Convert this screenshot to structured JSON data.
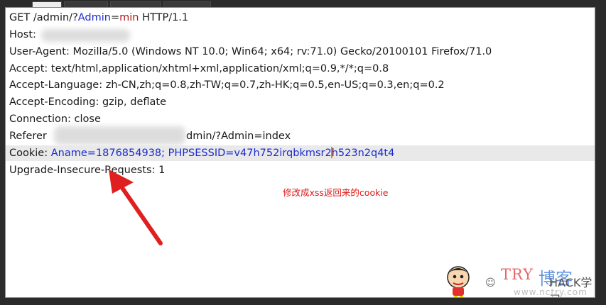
{
  "request": {
    "line1": {
      "method_path": "GET /admin/?",
      "param_key": "Admin",
      "eq": "=",
      "param_val": "min",
      "proto": " HTTP/1.1"
    },
    "host": "Host:",
    "user_agent": "User-Agent: Mozilla/5.0 (Windows NT 10.0; Win64; x64; rv:71.0) Gecko/20100101 Firefox/71.0",
    "accept": "Accept: text/html,application/xhtml+xml,application/xml;q=0.9,*/*;q=0.8",
    "accept_language": "Accept-Language: zh-CN,zh;q=0.8,zh-TW;q=0.7,zh-HK;q=0.5,en-US;q=0.3,en;q=0.2",
    "accept_encoding": "Accept-Encoding: gzip, deflate",
    "connection": "Connection: close",
    "referer_label": "Referer",
    "referer_tail": "dmin/?Admin=index",
    "cookie_label": "Cookie: ",
    "cookie_value_a": "Aname=1876854938; PHPSESSID=v47h752irqbkmsr2",
    "cookie_value_b": "h523n2q4t4",
    "upgrade": "Upgrade-Insecure-Requests: 1"
  },
  "annotation": {
    "note": "修改成xss返回来的cookie",
    "arrow_color": "#e02020"
  },
  "watermark": {
    "title": "TRY",
    "title2": "博客",
    "sub": "www.nctry.com",
    "brand": "HACK学习"
  },
  "colors": {
    "param": "#1a2ad0",
    "value": "#b01818",
    "highlight": "#e9e9e9",
    "caret": "#ff7a00"
  }
}
